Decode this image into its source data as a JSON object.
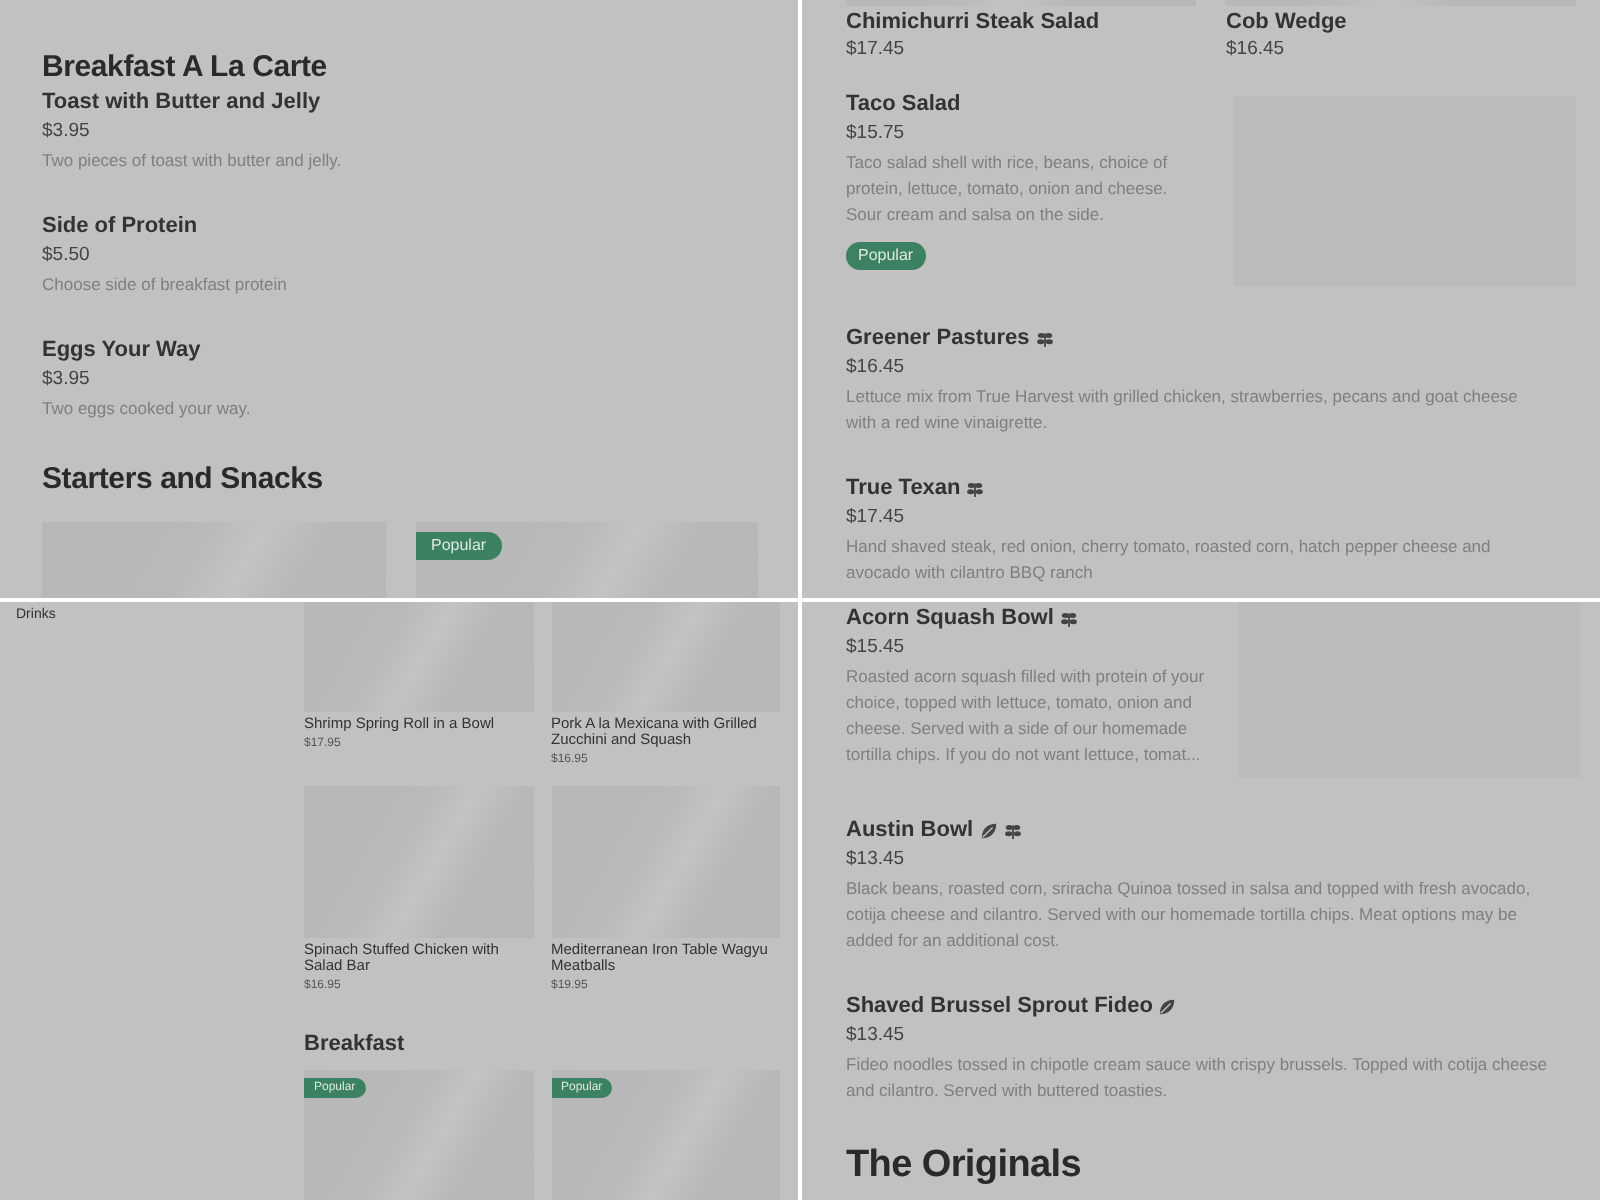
{
  "panels": [
    {
      "blocks": [
        {
          "kind": "heading",
          "text": "Breakfast A La Carte"
        },
        {
          "kind": "item",
          "name": "Toast with Butter and Jelly",
          "price": "$3.95",
          "description": "Two pieces of toast with butter and jelly.",
          "image": false
        },
        {
          "kind": "item",
          "name": "Side of Protein",
          "price": "$5.50",
          "description": "Choose side of breakfast protein",
          "image": false
        },
        {
          "kind": "item",
          "name": "Eggs Your Way",
          "price": "$3.95",
          "description": "Two eggs cooked your way.",
          "image": false
        },
        {
          "kind": "heading",
          "text": "Starters and Snacks"
        },
        {
          "kind": "cards",
          "cards": [
            {
              "kind": "card"
            },
            {
              "kind": "card",
              "badge": "Popular"
            }
          ]
        }
      ]
    },
    {
      "blocks": [
        {
          "kind": "cards",
          "cards": [
            {
              "kind": "card",
              "name": "Chimichurri Steak Salad",
              "price": "$17.45"
            },
            {
              "kind": "card",
              "name": "Cob Wedge",
              "price": "$16.45"
            }
          ]
        },
        {
          "kind": "item",
          "name": "Taco Salad",
          "price": "$15.75",
          "description": "Taco salad shell with rice, beans, choice of protein, lettuce, tomato, onion and cheese. Sour cream and salsa on the side.",
          "badge": "Popular",
          "image": true
        },
        {
          "kind": "item",
          "name": "Greener Pastures",
          "marks": [
            {
              "kind": "sprig"
            }
          ],
          "price": "$16.45",
          "description": "Lettuce mix from True Harvest with grilled chicken, strawberries, pecans and goat cheese with a red wine vinaigrette.",
          "image": false
        },
        {
          "kind": "item",
          "name": "True Texan",
          "marks": [
            {
              "kind": "sprig"
            }
          ],
          "price": "$17.45",
          "description": "Hand shaved steak, red onion, cherry tomato, roasted corn, hatch pepper cheese and avocado with cilantro BBQ ranch",
          "image": false
        }
      ]
    },
    {
      "sidebar": {
        "items": [
          "Drinks"
        ]
      },
      "blocks": [
        {
          "kind": "cards",
          "cards": [
            {
              "kind": "card",
              "name": "Shrimp Spring Roll in a Bowl",
              "price": "$17.95"
            },
            {
              "kind": "card",
              "name": "Pork A la Mexicana with Grilled Zucchini and Squash",
              "price": "$16.95"
            }
          ]
        },
        {
          "kind": "cards",
          "cards": [
            {
              "kind": "card",
              "name": "Spinach Stuffed Chicken with Salad Bar",
              "price": "$16.95"
            },
            {
              "kind": "card",
              "name": "Mediterranean Iron Table Wagyu Meatballs",
              "price": "$19.95"
            }
          ]
        },
        {
          "kind": "heading",
          "text": "Breakfast"
        },
        {
          "kind": "cards",
          "cards": [
            {
              "kind": "card",
              "badge": "Popular"
            },
            {
              "kind": "card",
              "badge": "Popular"
            }
          ]
        }
      ]
    },
    {
      "blocks": [
        {
          "kind": "item",
          "name": "Acorn Squash Bowl",
          "marks": [
            {
              "kind": "sprig"
            }
          ],
          "price": "$15.45",
          "description": "Roasted acorn squash filled with protein of your choice, topped with lettuce, tomato, onion and cheese. Served with a side of our homemade tortilla chips. If you do not want lettuce, tomat...",
          "image": true
        },
        {
          "kind": "item",
          "name": "Austin Bowl",
          "marks": [
            {
              "kind": "leaf"
            },
            {
              "kind": "sprig"
            }
          ],
          "price": "$13.45",
          "description": "Black beans, roasted corn, sriracha Quinoa tossed in salsa and topped with fresh avocado, cotija cheese and cilantro. Served with our homemade tortilla chips. Meat options may be added for an additional cost.",
          "image": false
        },
        {
          "kind": "item",
          "name": "Shaved Brussel Sprout Fideo",
          "marks": [
            {
              "kind": "leaf"
            }
          ],
          "price": "$13.45",
          "description": "Fideo noodles tossed in chipotle cream sauce with crispy brussels. Topped with cotija cheese and cilantro. Served with buttered toasties.",
          "image": false
        },
        {
          "kind": "heading",
          "text": "The Originals"
        }
      ]
    }
  ]
}
